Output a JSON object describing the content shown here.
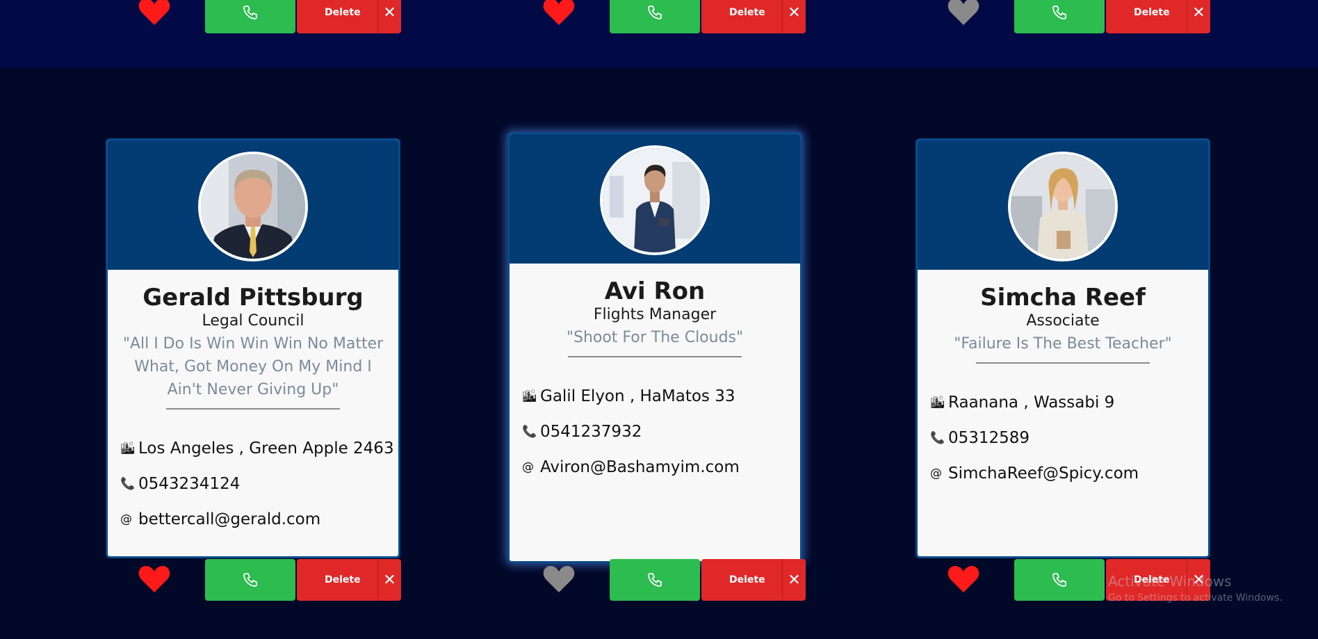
{
  "colors": {
    "page_bg": "#020828",
    "top_band": "#020a45",
    "card_header": "#023c73",
    "card_border": "#0a4b8c",
    "call_green": "#2cbc4f",
    "delete_red": "#e02828",
    "heart_liked": "#ff1a1a",
    "heart_unliked": "#8a8a8a"
  },
  "top_row": [
    {
      "liked": true,
      "delete_label": "Delete",
      "close_glyph": "✕"
    },
    {
      "liked": true,
      "delete_label": "Delete",
      "close_glyph": "✕"
    },
    {
      "liked": false,
      "delete_label": "Delete",
      "close_glyph": "✕"
    }
  ],
  "cards": [
    {
      "name": "Gerald Pittsburg",
      "title": "Legal Council",
      "quote": "\"All I Do Is Win Win Win No Matter What, Got Money On My Mind I Ain't Never Giving Up\"",
      "address": "Los Angeles , Green Apple 2463",
      "phone": "0543234124",
      "email": "bettercall@gerald.com",
      "address_icon": "🏙",
      "phone_icon": "📞",
      "email_icon": "@",
      "liked": true,
      "delete_label": "Delete",
      "close_glyph": "✕"
    },
    {
      "name": "Avi Ron",
      "title": "Flights Manager",
      "quote": "\"Shoot For The Clouds\"",
      "address": "Galil Elyon , HaMatos 33",
      "phone": "0541237932",
      "email": "Aviron@Bashamyim.com",
      "address_icon": "🏙",
      "phone_icon": "📞",
      "email_icon": "@",
      "liked": false,
      "delete_label": "Delete",
      "close_glyph": "✕"
    },
    {
      "name": "Simcha Reef",
      "title": "Associate",
      "quote": "\"Failure Is The Best Teacher\"",
      "address": "Raanana , Wassabi 9",
      "phone": "05312589",
      "email": "SimchaReef@Spicy.com",
      "address_icon": "🏙",
      "phone_icon": "📞",
      "email_icon": "@",
      "liked": true,
      "delete_label": "Delete",
      "close_glyph": "✕"
    }
  ],
  "watermark": {
    "title": "Activate Windows",
    "subtitle": "Go to Settings to activate Windows."
  }
}
